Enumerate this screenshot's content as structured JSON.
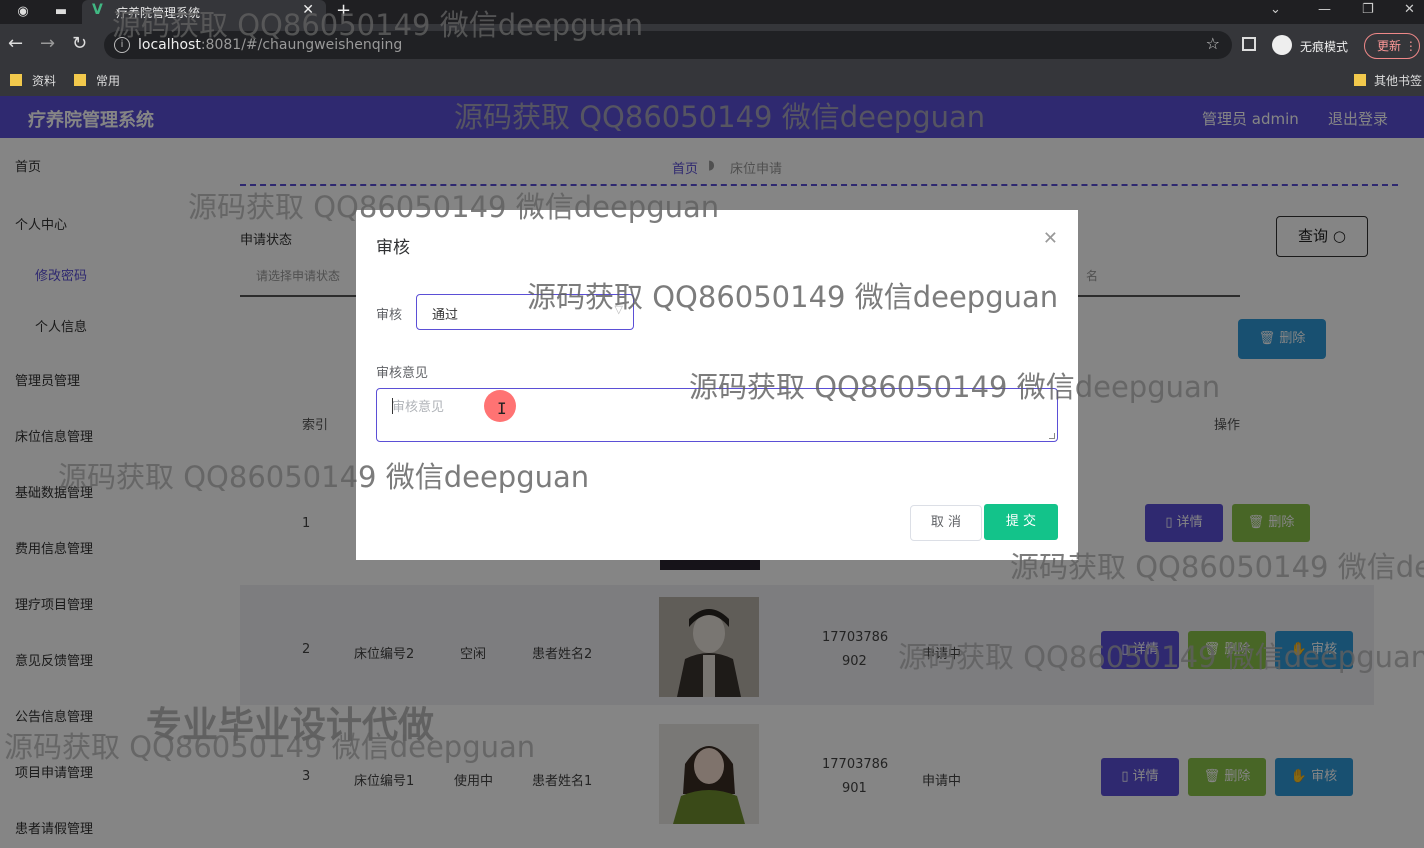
{
  "browser": {
    "tab_title": "疗养院管理系统",
    "url_host": "localhost",
    "url_rest": ":8081/#/chaungweishenqing",
    "incognito_label": "无痕模式",
    "update_label": "更新",
    "bookmarks": [
      "资料",
      "常用",
      "其他书签"
    ]
  },
  "app": {
    "title": "疗养院管理系统",
    "admin_label": "管理员 admin",
    "logout_label": "退出登录"
  },
  "sidebar": {
    "items": [
      "首页",
      "个人中心",
      "修改密码",
      "个人信息",
      "管理员管理",
      "床位信息管理",
      "基础数据管理",
      "费用信息管理",
      "理疗项目管理",
      "意见反馈管理",
      "公告信息管理",
      "项目申请管理",
      "患者请假管理"
    ]
  },
  "breadcrumb": {
    "home": "首页",
    "current": "床位申请"
  },
  "search": {
    "status_label": "申请状态",
    "status_placeholder": "请选择申请状态",
    "other_placeholder": "名",
    "query_label": "查询",
    "delete_label": "删除"
  },
  "table": {
    "headers": {
      "index": "索引",
      "op": "操作"
    },
    "rows": [
      {
        "index": "1",
        "phone1": "",
        "phone2": "",
        "bed": "",
        "state": "",
        "patient": "",
        "status": ""
      },
      {
        "index": "2",
        "bed": "床位编号2",
        "state": "空闲",
        "patient": "患者姓名2",
        "phone1": "17703786",
        "phone2": "902",
        "status": "申请中"
      },
      {
        "index": "3",
        "bed": "床位编号1",
        "state": "使用中",
        "patient": "患者姓名1",
        "phone1": "17703786",
        "phone2": "901",
        "status": "申请中"
      }
    ],
    "btn_detail": "详情",
    "btn_delete": "删除",
    "btn_audit": "审核"
  },
  "dialog": {
    "title": "审核",
    "audit_label": "审核",
    "audit_value": "通过",
    "opinion_label": "审核意见",
    "opinion_placeholder": "审核意见",
    "cancel": "取 消",
    "submit": "提 交"
  },
  "watermark": {
    "text": "源码获取 QQ86050149 微信deepguan",
    "promo": "专业毕业设计代做"
  },
  "colors": {
    "brand": "#5b4fd6",
    "submit": "#13c38a",
    "delete": "#8bc34a",
    "audit": "#2e9ad8"
  }
}
